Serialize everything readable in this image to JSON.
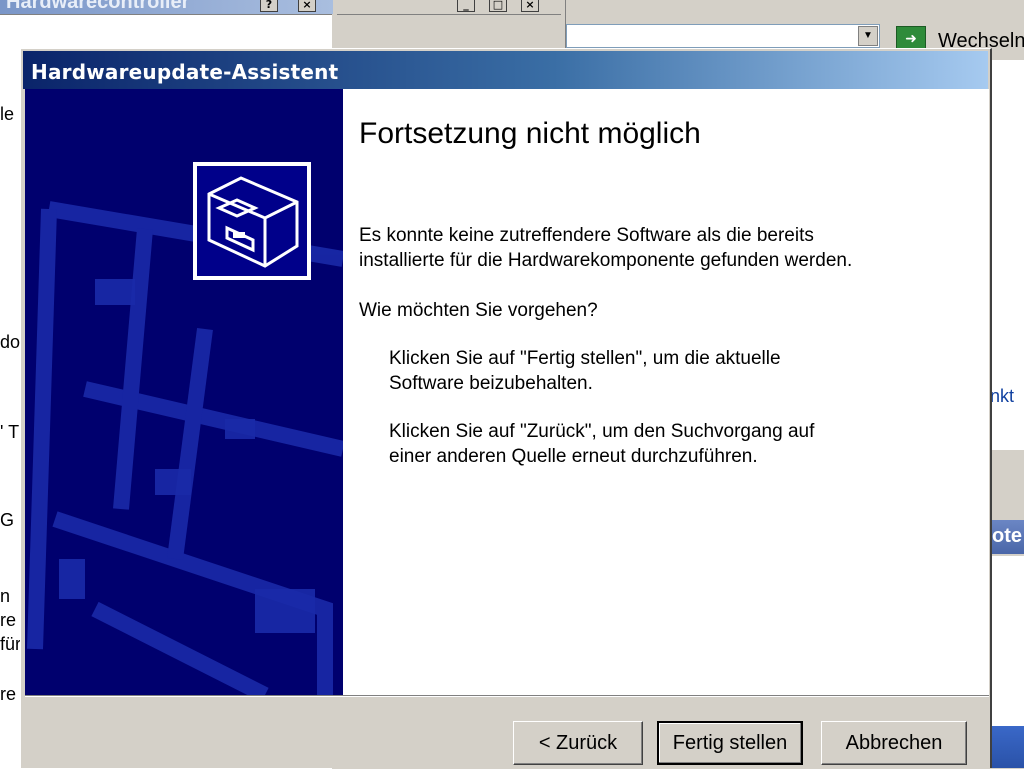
{
  "background": {
    "window1_title": "Hardwarecontroller",
    "window1_buttons": [
      "?",
      "×"
    ],
    "window2_buttons": [
      "_",
      "□",
      "×"
    ],
    "left_fragments": [
      "le",
      "do",
      "' T",
      "G",
      "n",
      "re",
      "für",
      "re"
    ],
    "switch_label": "Wechseln",
    "right_link_fragment": "nkt",
    "right_bar_fragment": "ote"
  },
  "wizard": {
    "title": "Hardwareupdate-Assistent",
    "heading": "Fortsetzung nicht möglich",
    "para1_line1": "Es konnte keine zutreffendere Software als die bereits",
    "para1_line2": "installierte für die Hardwarekomponente gefunden werden.",
    "question": "Wie möchten Sie vorgehen?",
    "option1_line1": "Klicken Sie auf \"Fertig stellen\", um die aktuelle",
    "option1_line2": "Software beizubehalten.",
    "option2_line1": "Klicken Sie auf \"Zurück\", um den Suchvorgang auf",
    "option2_line2": "einer anderen Quelle erneut durchzuführen."
  },
  "buttons": {
    "back": "< Zurück",
    "finish": "Fertig stellen",
    "cancel": "Abbrechen"
  },
  "icons": {
    "hardware": "hardware-icon",
    "switch": "switch-arrow-icon"
  },
  "colors": {
    "title_bar_start": "#0a246a",
    "side_panel": "#00006e",
    "face": "#d4d0c8"
  }
}
